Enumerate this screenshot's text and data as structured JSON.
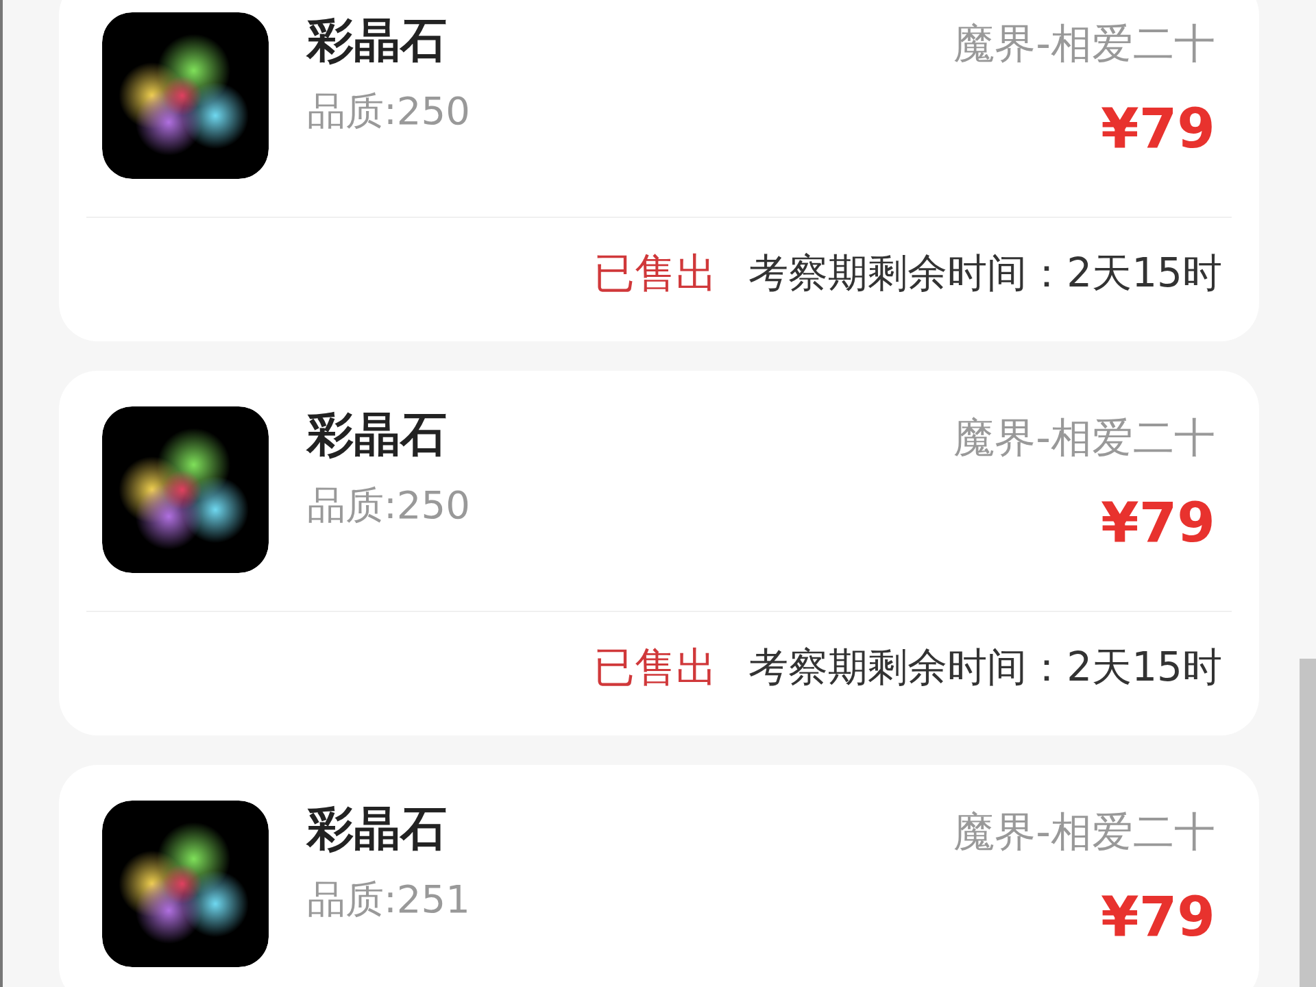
{
  "orders": [
    {
      "name": "彩晶石",
      "quality": "品质:250",
      "server": "魔界-相爱二十",
      "price": "¥79",
      "status": "已售出",
      "remaining": "考察期剩余时间：2天15时"
    },
    {
      "name": "彩晶石",
      "quality": "品质:250",
      "server": "魔界-相爱二十",
      "price": "¥79",
      "status": "已售出",
      "remaining": "考察期剩余时间：2天15时"
    },
    {
      "name": "彩晶石",
      "quality": "品质:251",
      "server": "魔界-相爱二十",
      "price": "¥79"
    }
  ]
}
